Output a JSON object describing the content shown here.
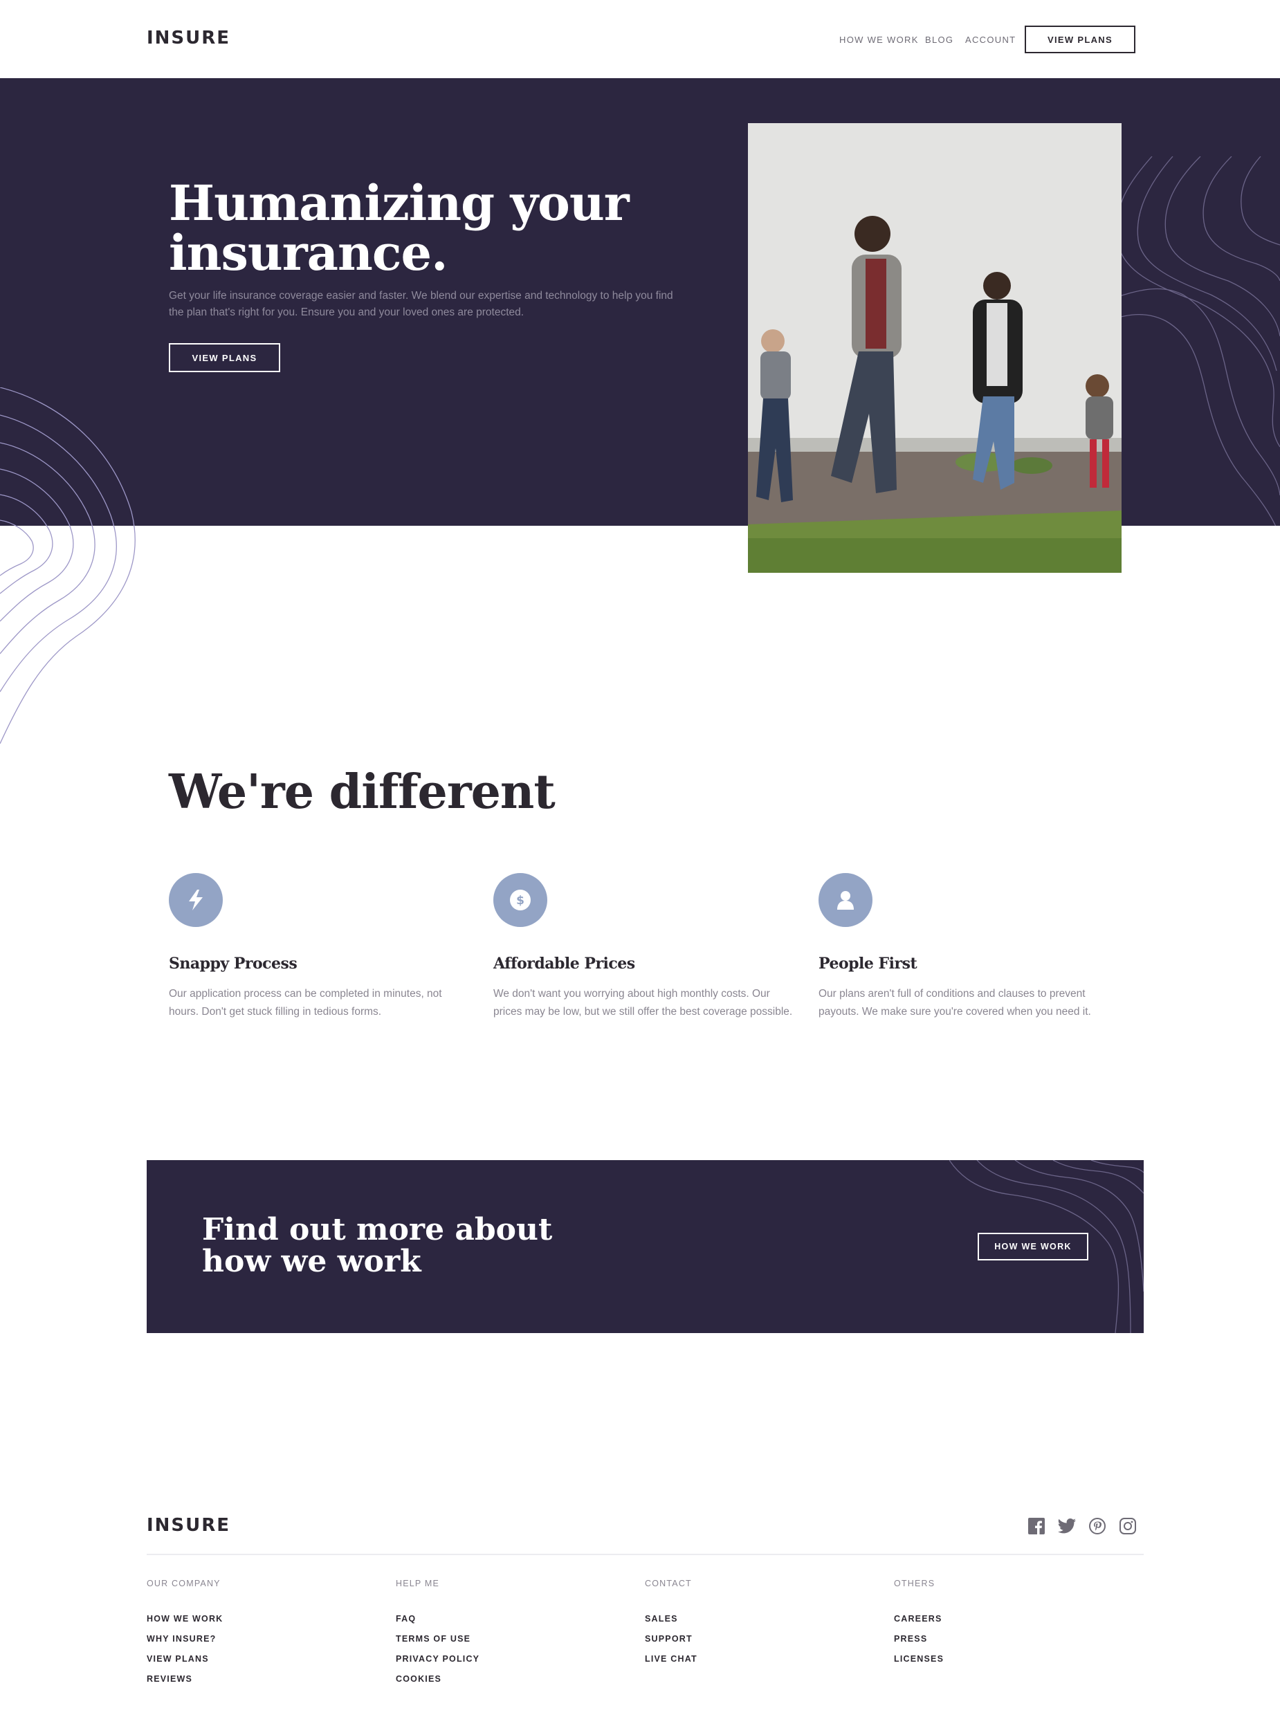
{
  "brand": {
    "logo": "INSURE"
  },
  "header": {
    "nav": [
      "HOW WE WORK",
      "BLOG",
      "ACCOUNT"
    ],
    "cta_label": "VIEW PLANS"
  },
  "hero": {
    "title": "Humanizing your insurance.",
    "text": "Get your life insurance coverage easier and faster. We blend our expertise and technology to help you find the plan that's right for you. Ensure you and your loved ones are protected.",
    "cta_label": "VIEW PLANS"
  },
  "different": {
    "title": "We're different",
    "features": [
      {
        "icon": "lightning-icon",
        "title": "Snappy Process",
        "text": "Our application process can be completed in minutes, not hours. Don't get stuck filling in tedious forms."
      },
      {
        "icon": "dollar-icon",
        "title": "Affordable Prices",
        "text": "We don't want you worrying about high monthly costs. Our prices may be low, but we still offer the best coverage possible."
      },
      {
        "icon": "person-icon",
        "title": "People First",
        "text": "Our plans aren't full of conditions and clauses to prevent payouts. We make sure you're covered when you need it."
      }
    ]
  },
  "cta": {
    "title": "Find out more about how we work",
    "button_label": "HOW WE WORK"
  },
  "footer": {
    "logo": "INSURE",
    "social": [
      "facebook-icon",
      "twitter-icon",
      "pinterest-icon",
      "instagram-icon"
    ],
    "columns": [
      {
        "heading": "OUR COMPANY",
        "links": [
          "HOW WE WORK",
          "WHY INSURE?",
          "VIEW PLANS",
          "REVIEWS"
        ]
      },
      {
        "heading": "HELP ME",
        "links": [
          "FAQ",
          "TERMS OF USE",
          "PRIVACY POLICY",
          "COOKIES"
        ]
      },
      {
        "heading": "CONTACT",
        "links": [
          "SALES",
          "SUPPORT",
          "LIVE CHAT"
        ]
      },
      {
        "heading": "OTHERS",
        "links": [
          "CAREERS",
          "PRESS",
          "LICENSES"
        ]
      }
    ]
  },
  "colors": {
    "dark_violet": "#2c2640",
    "accent_blue": "#93a4c5",
    "text_dark": "#2c2830",
    "text_muted": "#8a8691"
  }
}
